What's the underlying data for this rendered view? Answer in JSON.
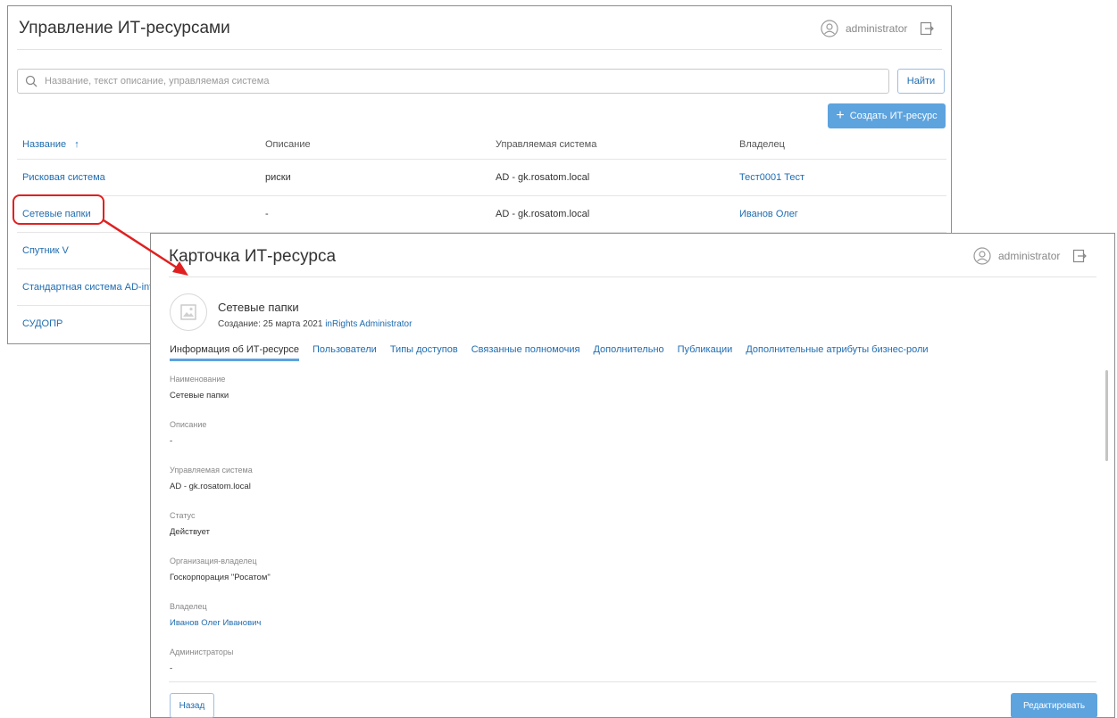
{
  "back_window": {
    "title": "Управление ИТ-ресурсами",
    "user": "administrator",
    "search": {
      "placeholder": "Название, текст описание, управляемая система",
      "value": ""
    },
    "find_label": "Найти",
    "create_label": "Создать ИТ-ресурс",
    "columns": [
      "Название",
      "Описание",
      "Управляемая система",
      "Владелец"
    ],
    "sort_indicator": "↑",
    "rows": [
      {
        "name": "Рисковая система",
        "description": "риски",
        "system": "AD - gk.rosatom.local",
        "owner": "Тест0001 Тест"
      },
      {
        "name": "Сетевые папки",
        "description": "-",
        "system": "AD - gk.rosatom.local",
        "owner": "Иванов Олег"
      },
      {
        "name": "Спутник V",
        "description": "",
        "system": "",
        "owner": ""
      },
      {
        "name": "Стандартная система AD-inte",
        "description": "",
        "system": "",
        "owner": ""
      },
      {
        "name": "СУДОПР",
        "description": "",
        "system": "",
        "owner": ""
      }
    ]
  },
  "front_window": {
    "title": "Карточка ИТ-ресурса",
    "user": "administrator",
    "resource_name": "Сетевые папки",
    "created_prefix": "Создание: 25 марта 2021",
    "created_by": "inRights Administrator",
    "tabs": [
      {
        "label": "Информация об ИТ-ресурсе",
        "active": true
      },
      {
        "label": "Пользователи",
        "active": false
      },
      {
        "label": "Типы доступов",
        "active": false
      },
      {
        "label": "Связанные полномочия",
        "active": false
      },
      {
        "label": "Дополнительно",
        "active": false
      },
      {
        "label": "Публикации",
        "active": false
      },
      {
        "label": "Дополнительные атрибуты бизнес-роли",
        "active": false
      }
    ],
    "fields": [
      {
        "label": "Наименование",
        "value": "Сетевые папки",
        "link": false
      },
      {
        "label": "Описание",
        "value": "-",
        "link": false
      },
      {
        "label": "Управляемая система",
        "value": "AD - gk.rosatom.local",
        "link": false
      },
      {
        "label": "Статус",
        "value": "Действует",
        "link": false
      },
      {
        "label": "Организация-владелец",
        "value": "Госкорпорация \"Росатом\"",
        "link": false
      },
      {
        "label": "Владелец",
        "value": "Иванов Олег Иванович",
        "link": true
      },
      {
        "label": "Администраторы",
        "value": "-",
        "link": false
      }
    ],
    "back_label": "Назад",
    "edit_label": "Редактировать"
  },
  "colors": {
    "accent": "#5da3de",
    "link": "#1f6cb0",
    "highlight": "#e02020"
  }
}
